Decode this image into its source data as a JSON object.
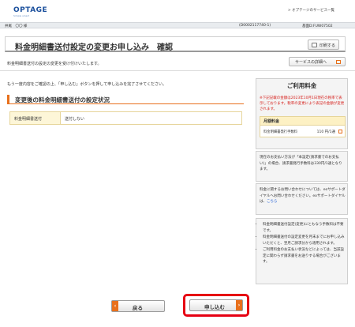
{
  "header": {
    "logo": "OPTAGE",
    "logo_sub": "Simple smart",
    "top_link": "> オプテージのサービス一覧"
  },
  "userbar": {
    "name": "井尾　〇〇 様",
    "customer_id": "(D0002117740-1)",
    "contract_id": "基面D:FUW07502"
  },
  "title": {
    "text": "料金明細書送付設定の変更お申し込み　確認",
    "print_label": "印刷する"
  },
  "accepted_message": "料金明細書送付の設定の変更を受け付けいたします。",
  "service_button": "サービスの詳細へ",
  "confirm_message": "もう一度内容をご確認の上、「申し込む」ボタンを押して申し込みを完了させてください。",
  "section": {
    "title": "変更後の料金明細書送付の設定状況",
    "row_label": "料金明細書送付",
    "row_value": "送付しない"
  },
  "sidebar": {
    "title": "ご利用料金",
    "notice": "※下記記載の金額は2023年10月1日現在の税率で表示しております。税率の変更により表記の金額が変更されます。",
    "fee_header": "月額料金",
    "fee_name": "料金明細書発行手数料",
    "fee_value": "110 円/1通",
    "box2": "現在のお支払い方法が「本設定(請求書でのお支払い)」の場合、請求書発行手数料は330円/1通となります。",
    "box3_text": "料金に関するお問い合わせについては、eoサポートダイヤルへお問い合わせください。eoサポートダイヤルは、",
    "box3_link": "こちら",
    "box4": [
      "料金明細書送付設定(変更)にともなう手数料は不要です。",
      "料金明細書送付の設定変更を月末までにお申し込みいただくと、翌月ご請求分から適用されます。",
      "ご利用料金のお支払い状況などによっては、当該設定に関わらず請求書をお送りする場合がございます。"
    ]
  },
  "buttons": {
    "back": "戻る",
    "submit": "申し込む"
  },
  "colors": {
    "accent": "#e8701c",
    "highlight": "#e60012",
    "link": "#1a5ad6",
    "notice": "#d6201c"
  }
}
